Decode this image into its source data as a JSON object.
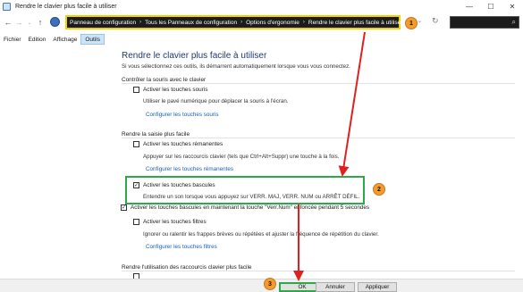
{
  "window": {
    "title": "Rendre le clavier plus facile à utiliser",
    "minimize_glyph": "—",
    "maximize_glyph": "☐",
    "close_glyph": "✕"
  },
  "address": {
    "back_glyph": "←",
    "forward_glyph": "→",
    "up_glyph": "↑",
    "dropdown_glyph": "⌄",
    "refresh_glyph": "↻",
    "search_glyph": "⌕",
    "crumbs": [
      "Panneau de configuration",
      "Tous les Panneaux de configuration",
      "Options d'ergonomie",
      "Rendre le clavier plus facile à utiliser"
    ],
    "crumb_sep": "›"
  },
  "menu": {
    "items": [
      "Fichier",
      "Edition",
      "Affichage",
      "Outils"
    ]
  },
  "main": {
    "title": "Rendre le clavier plus facile à utiliser",
    "intro": "Si vous sélectionnez ces outils, ils démarrent automatiquement lorsque vous vous connectez.",
    "sections": [
      {
        "title": "Contrôler la souris avec le clavier",
        "options": [
          {
            "label": "Activer les touches souris",
            "checked": false,
            "desc": "Utiliser le pavé numérique pour déplacer la souris à l'écran.",
            "link": "Configurer les touches souris"
          }
        ]
      },
      {
        "title": "Rendre la saisie plus facile",
        "options": [
          {
            "label": "Activer les touches rémanentes",
            "checked": false,
            "desc": "Appuyer sur les raccourcis clavier (tels que Ctrl+Alt+Suppr) une touche à la fois.",
            "link": "Configurer les touches rémanentes"
          },
          {
            "label": "Activer les touches bascules",
            "checked": true,
            "desc": "Entendre un son lorsque vous appuyez sur VERR. MAJ, VERR. NUM ou ARRÊT DÉFIL.",
            "sub": "Activer les touches bascules en maintenant la touche \"Verr.Num\" enfoncée pendant 5 secondes",
            "sub_checked": true
          },
          {
            "label": "Activer les touches filtres",
            "checked": false,
            "desc": "Ignorer ou ralentir les frappes brèves ou répétées et ajuster la fréquence de répétition du clavier.",
            "link": "Configurer les touches filtres"
          }
        ]
      },
      {
        "title": "Rendre l'utilisation des raccourcis clavier plus facile"
      }
    ]
  },
  "footer": {
    "ok": "OK",
    "cancel": "Annuler",
    "apply": "Appliquer"
  },
  "annotations": {
    "badges": [
      "1",
      "2",
      "3"
    ],
    "highlight_yellow": "#f2d300",
    "highlight_green": "#2fa84a",
    "arrow_color": "#e02020",
    "badge_color": "#f59b2e"
  },
  "checkmark": "✓"
}
